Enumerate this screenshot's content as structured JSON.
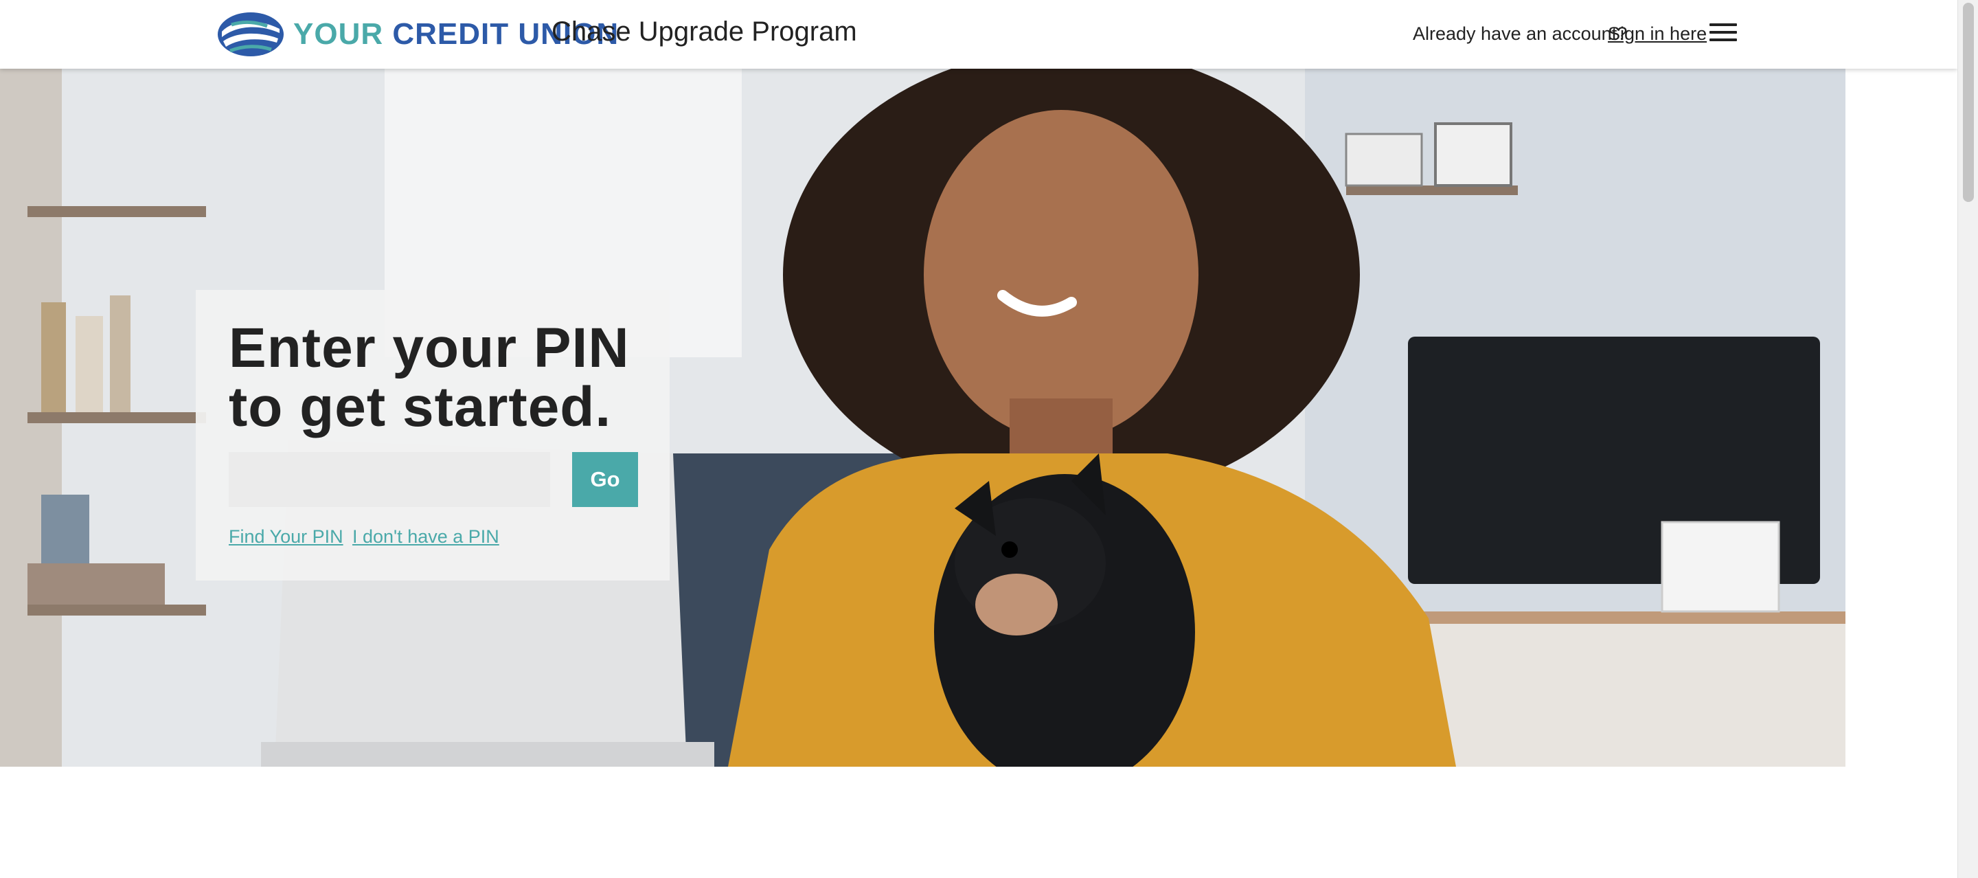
{
  "header": {
    "logo_prefix": "YOUR",
    "logo_suffix": "CREDIT UNION",
    "program_title": "Chase Upgrade Program",
    "account_prompt": "Already have an account?",
    "signin_label": "Sign in here",
    "menu_icon": "hamburger-menu-icon"
  },
  "hero": {
    "image_description_icon": "woman-with-dog-photo",
    "heading": "Enter your PIN to get started.",
    "pin_input": {
      "value": "",
      "placeholder": ""
    },
    "go_label": "Go",
    "find_pin_label": "Find Your PIN",
    "no_pin_label": "I don't have a PIN"
  },
  "colors": {
    "brand_blue": "#2d5aa8",
    "accent_teal": "#4aa9a9",
    "text": "#222222"
  }
}
